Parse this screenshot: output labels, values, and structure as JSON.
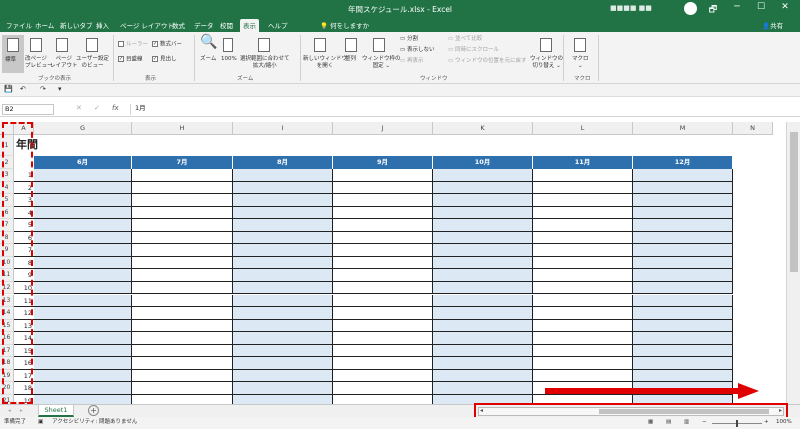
{
  "window": {
    "title": "年間スケジュール.xlsx  -  Excel",
    "user": "■■■■ ■■",
    "controls": [
      "🗗",
      "─",
      "☐",
      "✕"
    ]
  },
  "tabs": [
    "ファイル",
    "ホーム",
    "新しいタブ",
    "挿入",
    "ページ レイアウト",
    "数式",
    "データ",
    "校閲",
    "表示",
    "ヘルプ"
  ],
  "active_tab": "表示",
  "tell_me": "何をしますか",
  "share": "共有",
  "ribbon": {
    "book_views": {
      "normal": "標準",
      "page_break": "改ページ\nプレビュー",
      "page_layout": "ページ\nレイアウト",
      "custom": "ユーザー設定\nのビュー",
      "group": "ブックの表示"
    },
    "show": {
      "ruler": "ルーラー",
      "formula_bar": "数式バー",
      "gridlines": "目盛線",
      "headings": "見出し",
      "group": "表示"
    },
    "zoom": {
      "zoom": "ズーム",
      "hundred": "100%",
      "selection": "選択範囲に合わせて\n拡大/縮小",
      "group": "ズーム"
    },
    "window": {
      "new_window": "新しいウィンドウ\nを開く",
      "arrange": "整列",
      "freeze": "ウィンドウ枠の\n固定 ⌄",
      "split": "分割",
      "hide": "表示しない",
      "unhide": "再表示",
      "side_by_side": "並べて比較",
      "sync_scroll": "同時にスクロール",
      "reset_pos": "ウィンドウの位置を元に戻す",
      "switch": "ウィンドウの\n切り替え ⌄",
      "group": "ウィンドウ"
    },
    "macro": {
      "label": "マクロ\n⌄",
      "group": "マクロ"
    }
  },
  "qat": [
    "💾",
    "↶",
    "↷",
    "▾"
  ],
  "formula_bar": {
    "name_box": "B2",
    "fx": "fx",
    "content": "1月"
  },
  "grid": {
    "col_A": "A",
    "columns": [
      "G",
      "H",
      "I",
      "J",
      "K",
      "L",
      "M",
      "N"
    ],
    "months": [
      "6月",
      "7月",
      "8月",
      "9月",
      "10月",
      "11月",
      "12月"
    ],
    "title_partial": "年間",
    "row_numbers": [
      "1",
      "2",
      "3",
      "4",
      "5",
      "6",
      "7",
      "8",
      "9",
      "10",
      "11",
      "12",
      "13",
      "14",
      "15",
      "16",
      "17",
      "18",
      "19",
      "20",
      "21"
    ],
    "a_values": [
      "1",
      "2",
      "3",
      "4",
      "5",
      "6",
      "7",
      "8",
      "9",
      "10",
      "11",
      "12",
      "13",
      "14",
      "15",
      "16",
      "17",
      "18",
      "19"
    ]
  },
  "sheets": {
    "tab": "Sheet1",
    "add": "+"
  },
  "status": {
    "ready": "準備完了",
    "accessibility": "アクセシビリティ: 問題ありません",
    "zoom": "100%"
  }
}
